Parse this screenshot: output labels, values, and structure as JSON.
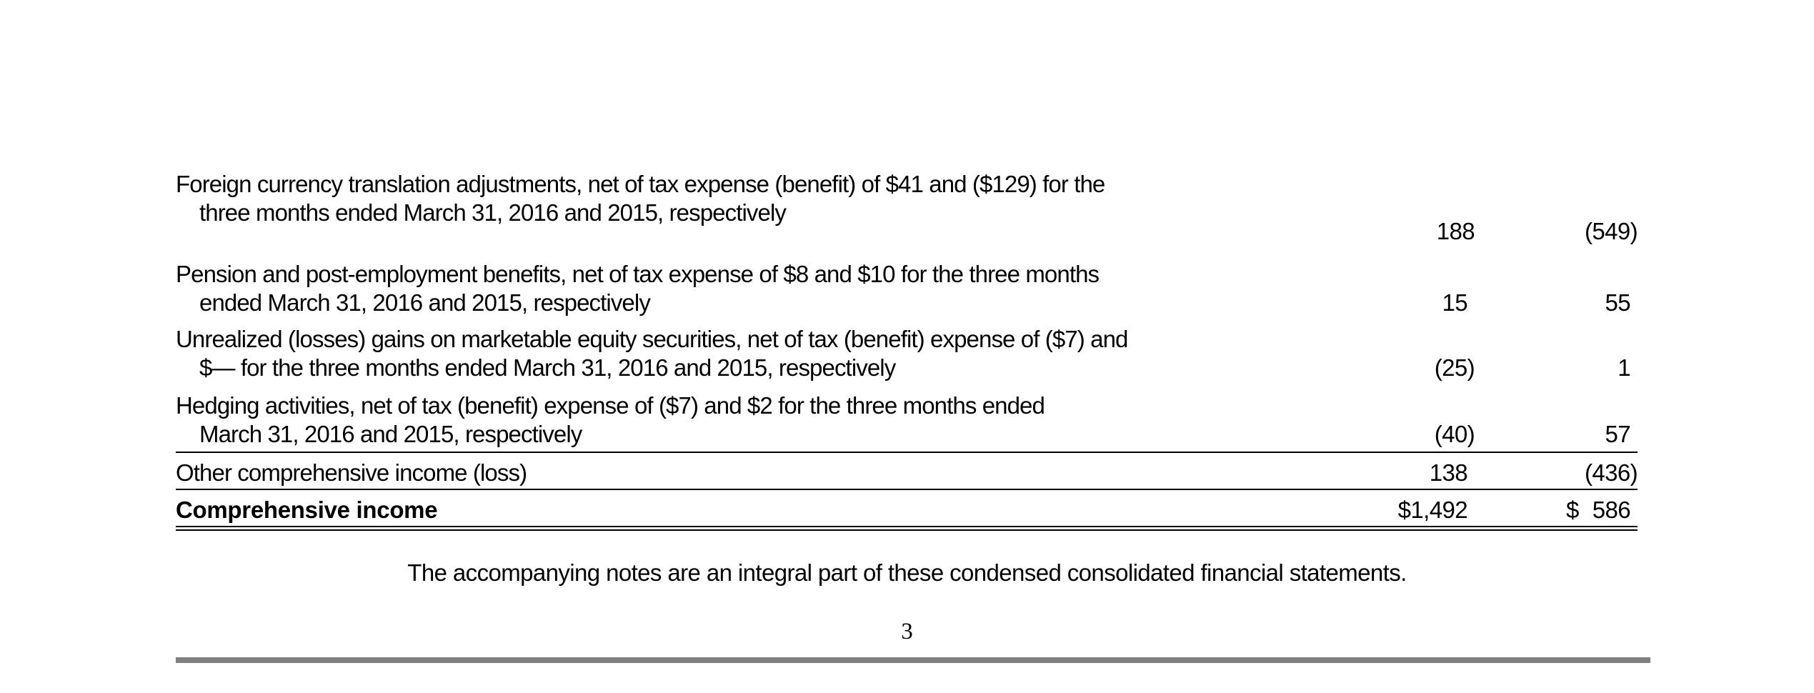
{
  "rows": [
    {
      "line1": "Foreign currency translation adjustments, net of tax expense (benefit) of $41 and ($129) for the",
      "line2": "three months ended March 31, 2016 and 2015, respectively",
      "col2016": "188",
      "col2015": "(549)"
    },
    {
      "line1": "Pension and post-employment benefits, net of tax expense of $8 and $10 for the three months",
      "line2": "ended March 31, 2016 and 2015, respectively",
      "col2016": "15",
      "col2015": "55"
    },
    {
      "line1": "Unrealized (losses) gains on marketable equity securities, net of tax (benefit) expense of ($7) and",
      "line2": "$— for the three months ended March 31, 2016 and 2015, respectively",
      "col2016": "(25)",
      "col2015": "1"
    },
    {
      "line1": "Hedging activities, net of tax (benefit) expense of ($7) and $2 for the three months ended",
      "line2": "March 31, 2016 and 2015, respectively",
      "col2016": "(40)",
      "col2015": "57"
    }
  ],
  "subtotal": {
    "label": "Other comprehensive income (loss)",
    "col2016": "138",
    "col2015": "(436)"
  },
  "total": {
    "label": "Comprehensive income",
    "col2016": "$1,492",
    "col2015_symbol": "$",
    "col2015": "586"
  },
  "footnote": "The accompanying notes are an integral part of these condensed consolidated financial statements.",
  "page_number": "3"
}
